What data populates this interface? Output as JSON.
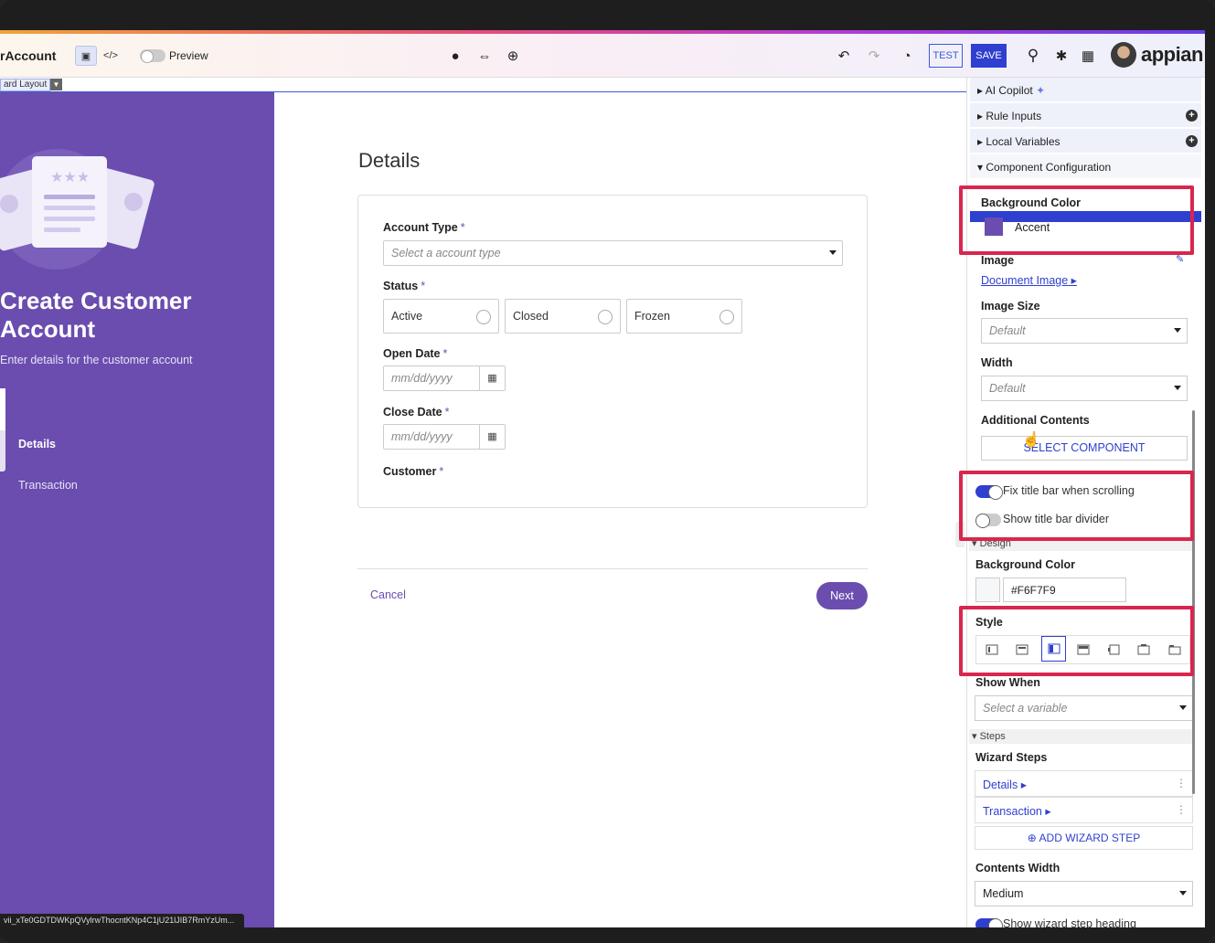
{
  "topbar": {
    "app_title": "rAccount",
    "preview_label": "Preview",
    "test_label": "TEST",
    "save_label": "SAVE",
    "logo_text": "appian"
  },
  "breadcrumb": {
    "label": "ard Layout"
  },
  "wizard": {
    "title": "Create Customer Account",
    "subtitle": "Enter details for the customer account",
    "steps": [
      "Details",
      "Transaction"
    ],
    "accent_color": "#6a4daf"
  },
  "form": {
    "page_title": "Details",
    "account_type": {
      "label": "Account Type",
      "placeholder": "Select a account type"
    },
    "status": {
      "label": "Status",
      "options": [
        "Active",
        "Closed",
        "Frozen"
      ]
    },
    "open_date": {
      "label": "Open Date",
      "placeholder": "mm/dd/yyyy"
    },
    "close_date": {
      "label": "Close Date",
      "placeholder": "mm/dd/yyyy"
    },
    "customer": {
      "label": "Customer"
    },
    "required_mark": "*",
    "cancel_label": "Cancel",
    "next_label": "Next"
  },
  "status_url": "vii_xTe0GDTDWKpQVylrwThocntKNp4C1jU21lJIB7RmYzUm...",
  "panel": {
    "accordions": [
      "AI Copilot",
      "Rule Inputs",
      "Local Variables",
      "Component Configuration"
    ],
    "bg_color_label": "Background Color",
    "bg_color_value": "Accent",
    "image_label": "Image",
    "image_link": "Document Image",
    "image_size_label": "Image Size",
    "image_size_value": "Default",
    "width_label": "Width",
    "width_value": "Default",
    "additional_label": "Additional Contents",
    "select_component": "SELECT COMPONENT",
    "fix_title_label": "Fix title bar when scrolling",
    "show_divider_label": "Show title bar divider",
    "design_section": "Design",
    "design_bg_label": "Background Color",
    "design_bg_value": "#F6F7F9",
    "style_label": "Style",
    "show_when_label": "Show When",
    "show_when_placeholder": "Select a variable",
    "steps_section": "Steps",
    "wizard_steps_label": "Wizard Steps",
    "wizard_steps": [
      "Details",
      "Transaction"
    ],
    "add_step": "ADD WIZARD STEP",
    "contents_width_label": "Contents Width",
    "contents_width_value": "Medium",
    "show_heading_label": "Show wizard step heading"
  },
  "highlight_color": "#d8264e"
}
